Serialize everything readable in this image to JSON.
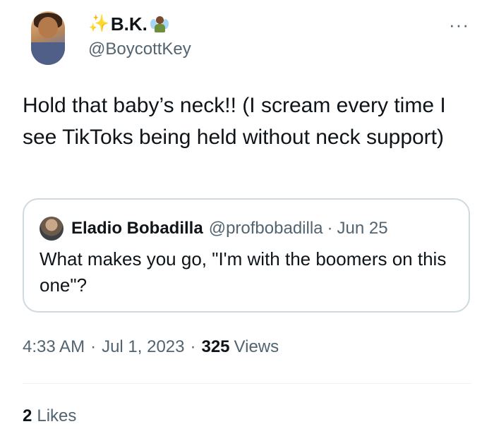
{
  "author": {
    "display_name": "B.K.",
    "handle": "@BoycottKey"
  },
  "icons": {
    "sparkles": "✨",
    "more": "···",
    "fairy": "fairy-emoji"
  },
  "tweet": {
    "text": "Hold that baby’s neck!! (I scream every time I see TikToks being held without neck support)"
  },
  "quoted_tweet": {
    "display_name": "Eladio Bobadilla",
    "handle": "@profbobadilla",
    "separator": "·",
    "date": "Jun 25",
    "text": "What makes you go, \"I'm with the boomers on this one\"?"
  },
  "meta": {
    "time": "4:33 AM",
    "separator": "·",
    "date": "Jul 1, 2023",
    "views_count": "325",
    "views_label": "Views"
  },
  "engagement": {
    "likes_count": "2",
    "likes_label": "Likes"
  },
  "colors": {
    "text_primary": "#0f1419",
    "text_secondary": "#536471",
    "border": "#cfd9de",
    "divider": "#eff3f4",
    "sparkle": "#f4b400"
  }
}
